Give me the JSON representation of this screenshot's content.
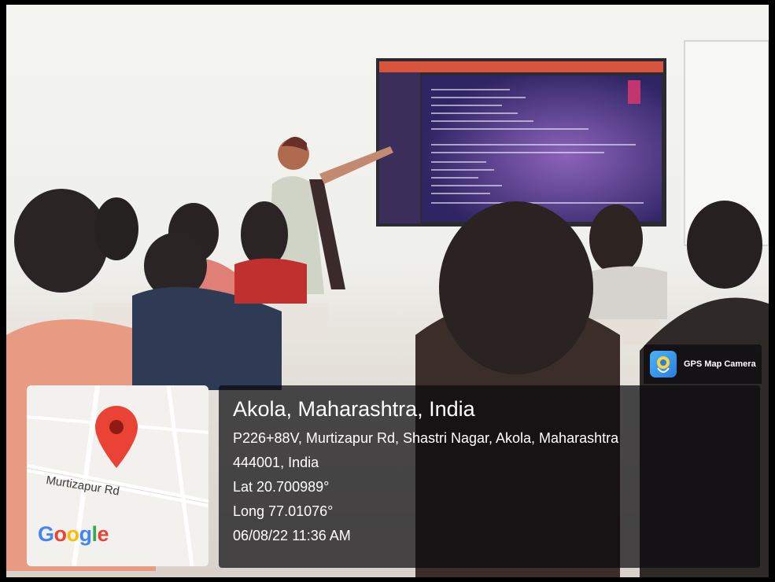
{
  "photo": {
    "description_icon": "classroom-photo"
  },
  "gps_badge": {
    "app_name": "GPS Map Camera",
    "icon": "gps-map-camera-app-icon"
  },
  "location": {
    "title": "Akola, Maharashtra, India",
    "address_line_1": "P226+88V, Murtizapur Rd, Shastri Nagar, Akola, Maharashtra",
    "address_line_2": "444001, India",
    "latitude": "Lat 20.700989°",
    "longitude": "Long 77.01076°",
    "datetime": "06/08/22 11:36 AM"
  },
  "map": {
    "road_label": "Murtizapur Rd",
    "logo_letters": [
      "G",
      "o",
      "o",
      "g",
      "l",
      "e"
    ],
    "pin_icon": "map-pin-icon",
    "pin_color": "#ea4335"
  },
  "colors": {
    "overlay": "#0a0a0e",
    "text": "#ffffff"
  }
}
